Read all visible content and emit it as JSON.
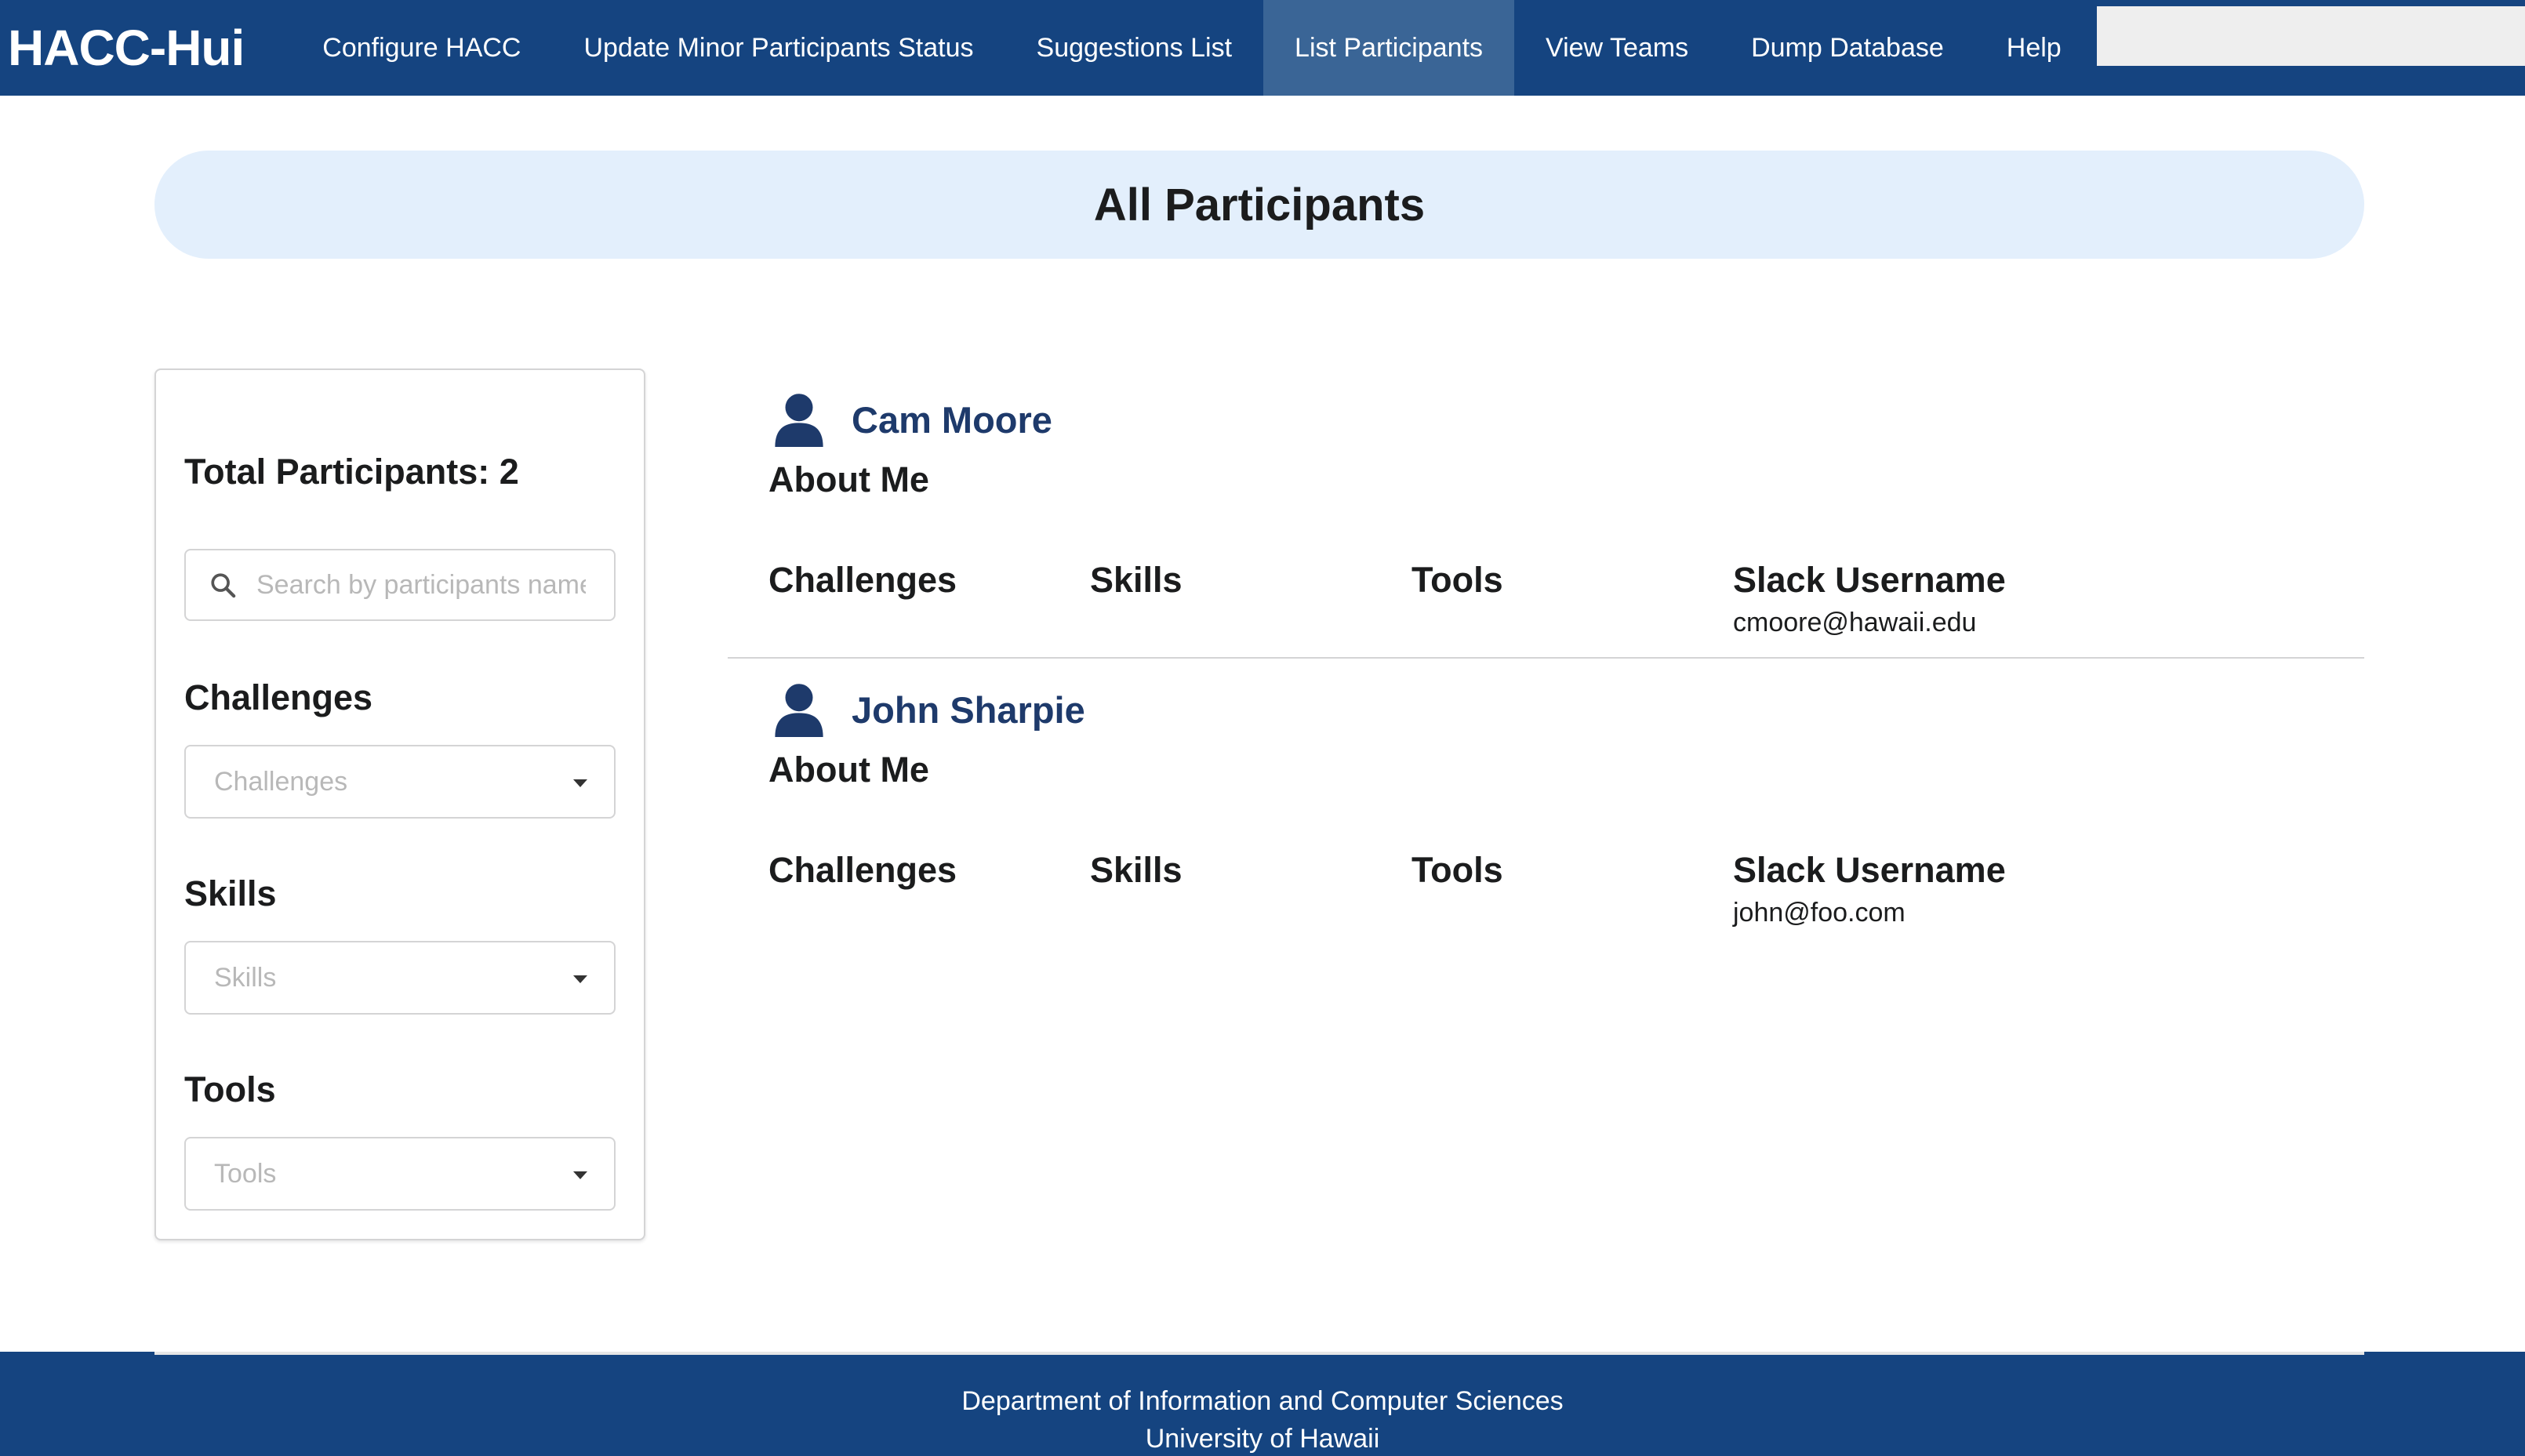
{
  "navbar": {
    "brand": "HACC-Hui",
    "items": [
      {
        "label": "Configure HACC",
        "active": false
      },
      {
        "label": "Update Minor Participants Status",
        "active": false
      },
      {
        "label": "Suggestions List",
        "active": false
      },
      {
        "label": "List Participants",
        "active": true
      },
      {
        "label": "View Teams",
        "active": false
      },
      {
        "label": "Dump Database",
        "active": false
      },
      {
        "label": "Help",
        "active": false
      }
    ]
  },
  "header": {
    "title": "All Participants"
  },
  "sidebar": {
    "total_label": "Total Participants: 2",
    "search_placeholder": "Search by participants name...",
    "filters": [
      {
        "label": "Challenges",
        "placeholder": "Challenges"
      },
      {
        "label": "Skills",
        "placeholder": "Skills"
      },
      {
        "label": "Tools",
        "placeholder": "Tools"
      }
    ]
  },
  "participants": [
    {
      "name": "Cam Moore",
      "about_label": "About Me",
      "challenges_label": "Challenges",
      "skills_label": "Skills",
      "tools_label": "Tools",
      "slack_label": "Slack Username",
      "slack_value": "cmoore@hawaii.edu"
    },
    {
      "name": "John Sharpie",
      "about_label": "About Me",
      "challenges_label": "Challenges",
      "skills_label": "Skills",
      "tools_label": "Tools",
      "slack_label": "Slack Username",
      "slack_value": "john@foo.com"
    }
  ],
  "footer": {
    "line1": "Department of Information and Computer Sciences",
    "line2": "University of Hawaii"
  },
  "colors": {
    "navbar_bg": "#154480",
    "nav_active_bg": "#3a6596",
    "header_bg": "#e3effc",
    "participant_name": "#1e3a6b"
  },
  "icons": {
    "search": "search-icon",
    "user": "user-icon",
    "caret": "caret-down-icon"
  }
}
